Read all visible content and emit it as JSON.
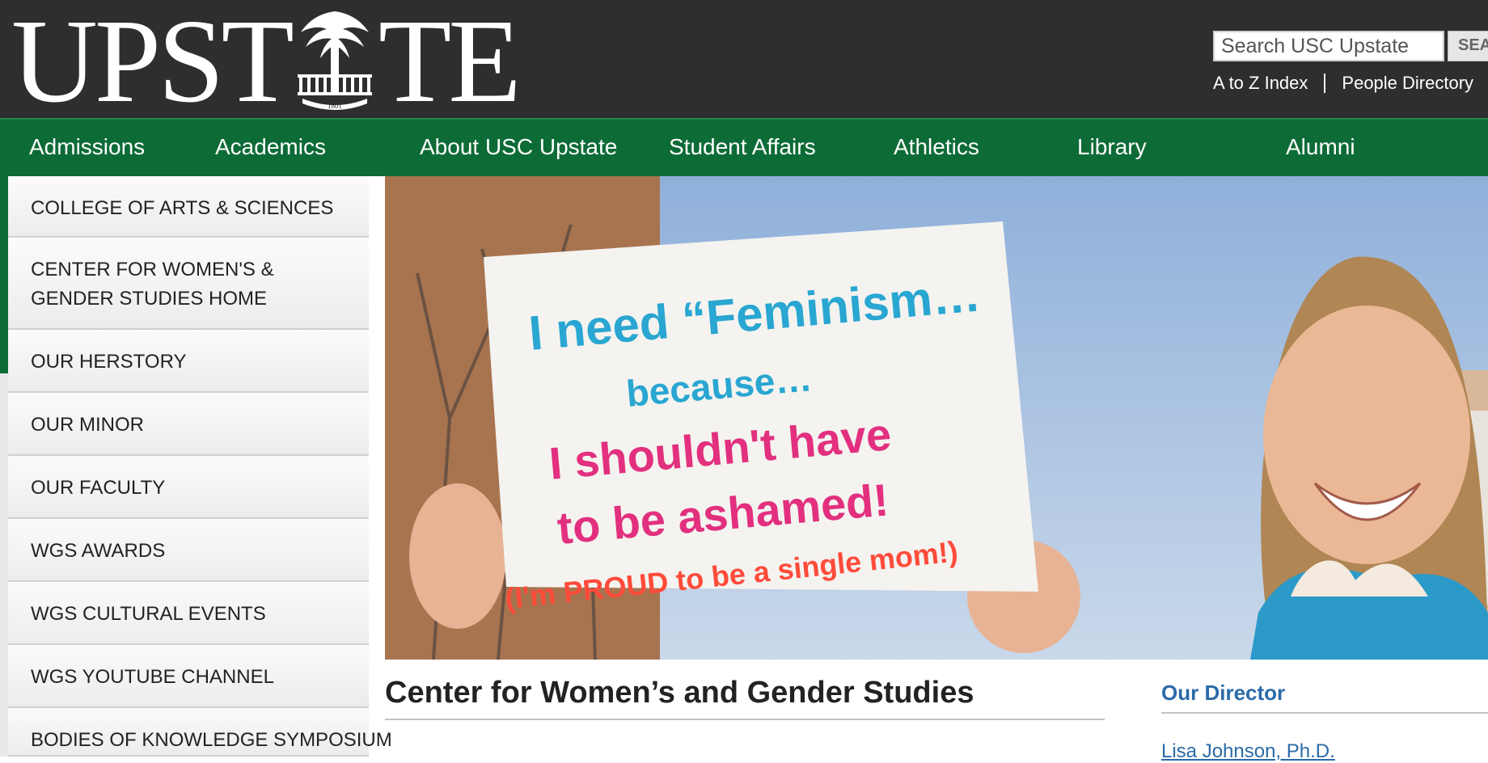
{
  "header": {
    "logo_left": "UPST",
    "logo_right": "TE",
    "logo_year": "1801",
    "search": {
      "placeholder": "Search USC Upstate",
      "button_label": "SEA"
    },
    "util_links": [
      "A to Z Index",
      "People Directory"
    ]
  },
  "nav": {
    "items": [
      "Admissions",
      "Academics",
      "About USC Upstate",
      "Student Affairs",
      "Athletics",
      "Library",
      "Alumni"
    ]
  },
  "sidebar": {
    "items": [
      "COLLEGE OF ARTS & SCIENCES",
      "CENTER FOR WOMEN'S & GENDER STUDIES HOME",
      "OUR HERSTORY",
      "OUR MINOR",
      "OUR FACULTY",
      "WGS AWARDS",
      "WGS CULTURAL EVENTS",
      "WGS YOUTUBE CHANNEL",
      "BODIES OF KNOWLEDGE SYMPOSIUM"
    ]
  },
  "hero": {
    "sign_lines": [
      "I need “Feminism…",
      "because…",
      "I shouldn't have",
      "to be ashamed!",
      "(I'm PROUD to be a single mom!)"
    ]
  },
  "main": {
    "title": "Center for Women’s and Gender Studies"
  },
  "director": {
    "heading": "Our Director",
    "name": "Lisa Johnson, Ph.D."
  },
  "colors": {
    "header_bg": "#2e2e2e",
    "nav_green": "#0d6b36",
    "link_blue": "#2b6aa8"
  }
}
